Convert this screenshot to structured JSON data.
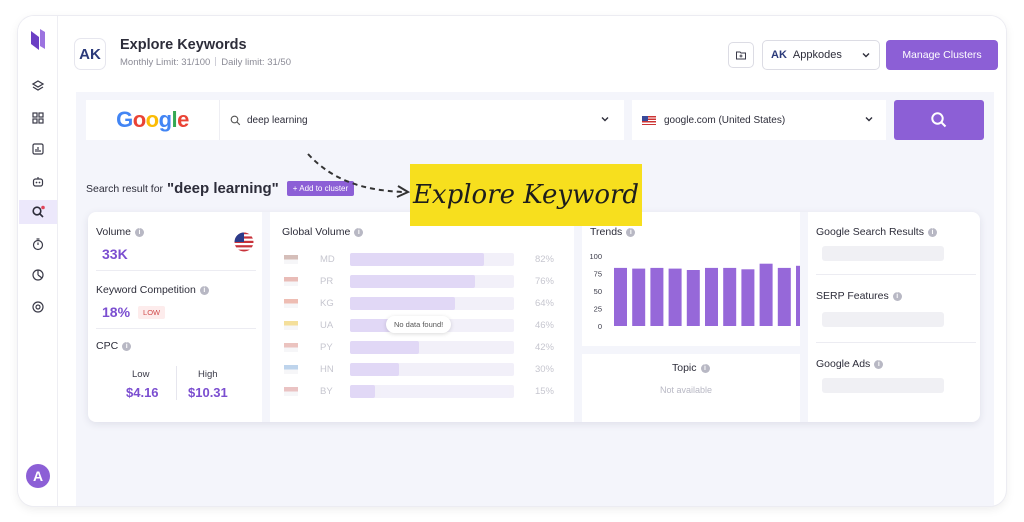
{
  "header": {
    "title": "Explore Keywords",
    "monthly_limit": "Monthly Limit: 31/100",
    "daily_limit": "Daily limit: 31/50",
    "app_name": "Appkodes",
    "app_logo_text": "AK",
    "manage_clusters": "Manage Clusters"
  },
  "sidebar": {
    "avatar_initial": "A",
    "items": [
      "layers-icon",
      "grid-icon",
      "chart-icon",
      "bot-icon",
      "search-icon",
      "timer-icon",
      "pie-icon",
      "target-icon"
    ]
  },
  "search": {
    "engine": "Google",
    "keyword": "deep learning",
    "country": "google.com (United States)"
  },
  "banner": {
    "text": "Explore Keyword"
  },
  "result": {
    "prefix": "Search result for",
    "keyword": "\"deep learning\"",
    "add_cluster": "+ Add to cluster"
  },
  "metrics": {
    "volume_label": "Volume",
    "volume_value": "33K",
    "competition_label": "Keyword Competition",
    "competition_value": "18%",
    "competition_badge": "LOW",
    "cpc_label": "CPC",
    "cpc_low_label": "Low",
    "cpc_low_value": "$4.16",
    "cpc_high_label": "High",
    "cpc_high_value": "$10.31"
  },
  "global_volume": {
    "label": "Global Volume",
    "no_data": "No data found!",
    "rows": [
      {
        "code": "MD",
        "pct_label": "82%",
        "pct": 0.82
      },
      {
        "code": "PR",
        "pct_label": "76%",
        "pct": 0.76
      },
      {
        "code": "KG",
        "pct_label": "64%",
        "pct": 0.64
      },
      {
        "code": "UA",
        "pct_label": "46%",
        "pct": 0.46
      },
      {
        "code": "PY",
        "pct_label": "42%",
        "pct": 0.42
      },
      {
        "code": "HN",
        "pct_label": "30%",
        "pct": 0.3
      },
      {
        "code": "BY",
        "pct_label": "15%",
        "pct": 0.15
      }
    ]
  },
  "trends": {
    "label": "Trends",
    "bar_color": "#9668d9"
  },
  "chart_data": {
    "type": "bar",
    "title": "Trends",
    "y_ticks": [
      "100",
      "75",
      "50",
      "25",
      "0"
    ],
    "ylim": [
      0,
      100
    ],
    "values": [
      83,
      82,
      83,
      82,
      80,
      83,
      83,
      81,
      89,
      83,
      86
    ]
  },
  "topic": {
    "label": "Topic",
    "value": "Not available"
  },
  "right": {
    "serp_results": "Google Search Results",
    "serp_features": "SERP Features",
    "google_ads": "Google Ads"
  },
  "colors": {
    "accent": "#8c5fd6",
    "banner": "#f7df1e"
  }
}
